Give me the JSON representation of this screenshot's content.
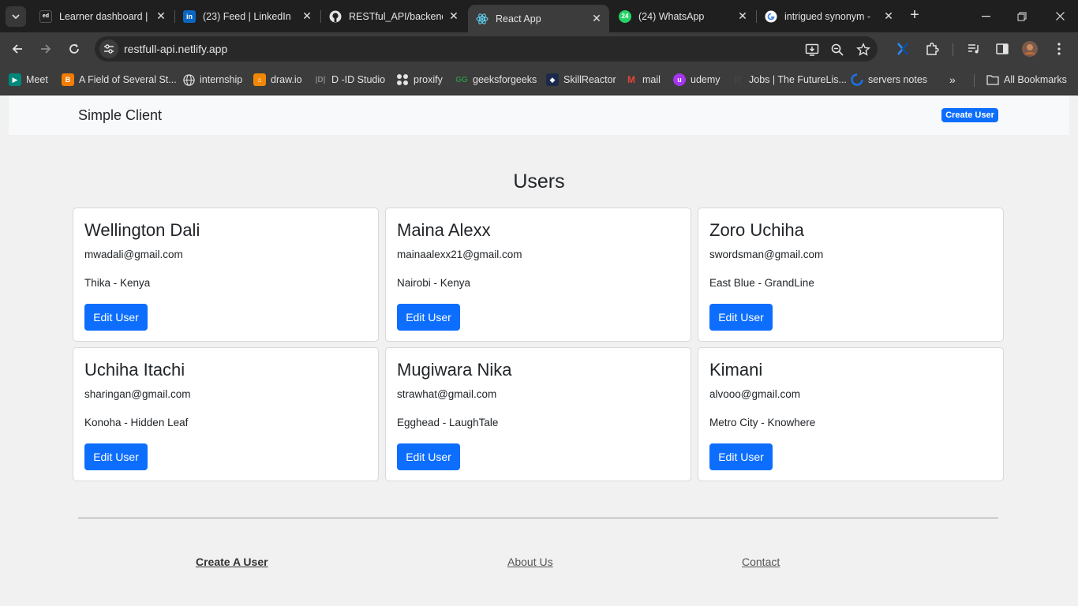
{
  "browser": {
    "tabs": [
      {
        "title": "Learner dashboard | N",
        "icon": "edx-icon"
      },
      {
        "title": "(23) Feed | LinkedIn",
        "icon": "linkedin-icon"
      },
      {
        "title": "RESTful_API/backend",
        "icon": "github-icon"
      },
      {
        "title": "React App",
        "icon": "react-icon",
        "active": true
      },
      {
        "title": "(24) WhatsApp",
        "icon": "whatsapp-icon"
      },
      {
        "title": "intrigued synonym - ",
        "icon": "google-icon"
      }
    ],
    "url": "restfull-api.netlify.app",
    "bookmarks": [
      {
        "label": "Meet",
        "icon": "meet-icon"
      },
      {
        "label": "A Field of Several St...",
        "icon": "blogger-icon"
      },
      {
        "label": "internship",
        "icon": "globe-icon"
      },
      {
        "label": "draw.io",
        "icon": "drawio-icon"
      },
      {
        "label": "D -ID Studio",
        "icon": "did-icon"
      },
      {
        "label": "proxify",
        "icon": "proxify-icon"
      },
      {
        "label": "geeksforgeeks",
        "icon": "gfg-icon"
      },
      {
        "label": "SkillReactor",
        "icon": "skillreactor-icon"
      },
      {
        "label": "mail",
        "icon": "gmail-icon"
      },
      {
        "label": "udemy",
        "icon": "udemy-icon"
      },
      {
        "label": "Jobs | The FutureLis...",
        "icon": "futurelist-icon"
      },
      {
        "label": "servers notes",
        "icon": "servers-icon"
      }
    ],
    "all_bookmarks": "All Bookmarks",
    "whatsapp_badge": "24"
  },
  "app": {
    "brand": "Simple Client",
    "create_button": "Create User",
    "heading": "Users",
    "users": [
      {
        "name": "Wellington Dali",
        "email": "mwadali@gmail.com",
        "location": "Thika - Kenya"
      },
      {
        "name": "Maina Alexx",
        "email": "mainaalexx21@gmail.com",
        "location": "Nairobi - Kenya"
      },
      {
        "name": "Zoro Uchiha",
        "email": "swordsman@gmail.com",
        "location": "East Blue - GrandLine"
      },
      {
        "name": "Uchiha Itachi",
        "email": "sharingan@gmail.com",
        "location": "Konoha - Hidden Leaf"
      },
      {
        "name": "Mugiwara Nika",
        "email": "strawhat@gmail.com",
        "location": "Egghead - LaughTale"
      },
      {
        "name": "Kimani",
        "email": "alvooo@gmail.com",
        "location": "Metro City - Knowhere"
      }
    ],
    "edit_label": "Edit User",
    "footer": {
      "create": "Create A User",
      "about": "About Us",
      "contact": "Contact"
    }
  },
  "colors": {
    "primary": "#0d6efd",
    "navbar": "#f8f9fa",
    "page_bg": "#f1f1f1",
    "chrome_dark": "#1f1f1f",
    "chrome_toolbar": "#3c3c3c"
  }
}
